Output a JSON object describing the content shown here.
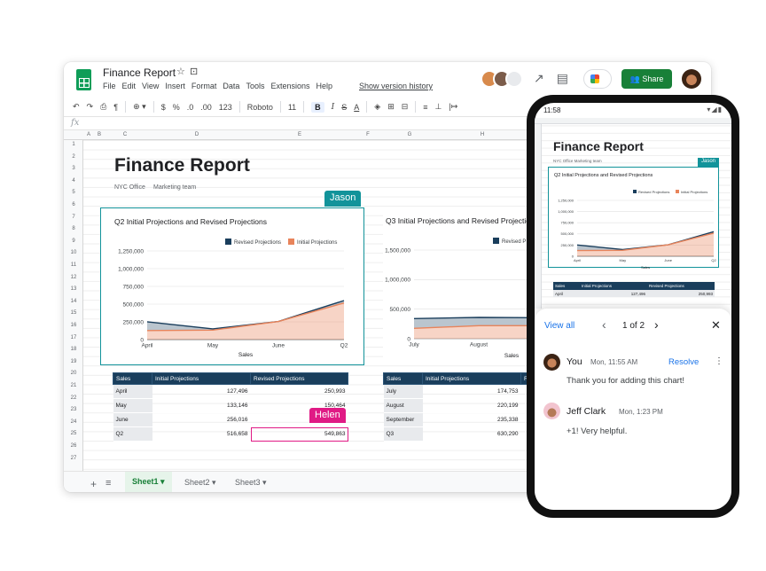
{
  "header": {
    "doc_title": "Finance Report",
    "menu": [
      "File",
      "Edit",
      "View",
      "Insert",
      "Format",
      "Data",
      "Tools",
      "Extensions",
      "Help"
    ],
    "version_history": "Show version history",
    "share_label": "Share"
  },
  "toolbar": {
    "zoom_dropdown": "",
    "format_123": "123",
    "currency": "$",
    "percent": "%",
    "dec_less": ".0",
    "dec_more": ".00",
    "font": "Roboto",
    "font_size": "11",
    "bold": "B",
    "italic": "I",
    "strike": "S",
    "underline": "A",
    "fx": "fx"
  },
  "columns": [
    "A",
    "B",
    "C",
    "D",
    "E",
    "F",
    "G",
    "H"
  ],
  "rows": [
    "1",
    "2",
    "3",
    "4",
    "5",
    "6",
    "7",
    "8",
    "9",
    "10",
    "11",
    "12",
    "13",
    "14",
    "15",
    "16",
    "17",
    "18",
    "19",
    "20",
    "21",
    "22",
    "23",
    "24",
    "25",
    "26",
    "27"
  ],
  "sheet": {
    "title": "Finance Report",
    "subtitle_office": "NYC Office",
    "subtitle_team": "Marketing team"
  },
  "collaborators": {
    "jason": "Jason",
    "helen": "Helen"
  },
  "colors": {
    "revised": "#1a3e5c",
    "initial": "#e8845b",
    "teal": "#12939a",
    "helen": "#e01a85",
    "share_green": "#188038"
  },
  "chart_data": [
    {
      "type": "area",
      "title": "Q2 Initial Projections and Revised Projections",
      "categories": [
        "April",
        "May",
        "June",
        "Q2"
      ],
      "xlabel": "Sales",
      "ylabel": "",
      "ylim": [
        0,
        1250000
      ],
      "yticks": [
        "0",
        "250,000",
        "500,000",
        "750,000",
        "1,000,000",
        "1,250,000"
      ],
      "legend": "top-right",
      "series": [
        {
          "name": "Revised Projections",
          "values": [
            250993,
            150464,
            256016,
            549863
          ]
        },
        {
          "name": "Initial Projections",
          "values": [
            127496,
            133146,
            256016,
            516658
          ]
        }
      ]
    },
    {
      "type": "area",
      "title": "Q3 Initial Projections and Revised Projectio",
      "categories": [
        "July",
        "August"
      ],
      "xlabel": "Sales",
      "ylabel": "",
      "ylim": [
        0,
        1500000
      ],
      "yticks": [
        "0",
        "500,000",
        "1,000,000",
        "1,500,000"
      ],
      "legend": "top-right",
      "series": [
        {
          "name": "Revised P",
          "values": [
            174753,
            220199
          ]
        },
        {
          "name": "",
          "values": [
            174753,
            220199
          ]
        }
      ]
    }
  ],
  "table_q2": {
    "headers": [
      "Sales",
      "Initial Projections",
      "Revised Projections"
    ],
    "rows": [
      [
        "April",
        "127,496",
        "250,993"
      ],
      [
        "May",
        "133,146",
        "150,464"
      ],
      [
        "June",
        "256,016",
        ""
      ],
      [
        "Q2",
        "516,658",
        "549,863"
      ]
    ]
  },
  "table_q3": {
    "headers": [
      "Sales",
      "Initial Projections",
      "Re"
    ],
    "rows": [
      [
        "July",
        "174,753"
      ],
      [
        "August",
        "220,199"
      ],
      [
        "September",
        "235,338"
      ],
      [
        "Q3",
        "630,290"
      ]
    ]
  },
  "sheet_tabs": [
    "Sheet1",
    "Sheet2",
    "Sheet3"
  ],
  "phone": {
    "time": "11:58",
    "title": "Finance Report",
    "subtitle": "NYC Office   Marketing team",
    "jason": "Jason",
    "chart_title": "Q2 Initial Projections and Revised Projections",
    "legend_revised": "Revised Projections",
    "legend_initial": "Initial Projections",
    "yticks": [
      "1,250,000",
      "1,000,000",
      "750,000",
      "500,000",
      "250,000",
      "0"
    ],
    "xticks": [
      "April",
      "May",
      "June",
      "Q2"
    ],
    "xlabel": "Sales",
    "table_headers": [
      "Sales",
      "Initial Projections",
      "Revised Projections"
    ],
    "table_row": [
      "April",
      "127,496",
      "250,993"
    ]
  },
  "comments": {
    "view_all": "View all",
    "page_count": "1 of 2",
    "resolve": "Resolve",
    "items": [
      {
        "author": "You",
        "time": "Mon, 11:55 AM",
        "text": "Thank you for adding this chart!"
      },
      {
        "author": "Jeff Clark",
        "time": "Mon, 1:23 PM",
        "text": "+1! Very helpful."
      }
    ]
  }
}
